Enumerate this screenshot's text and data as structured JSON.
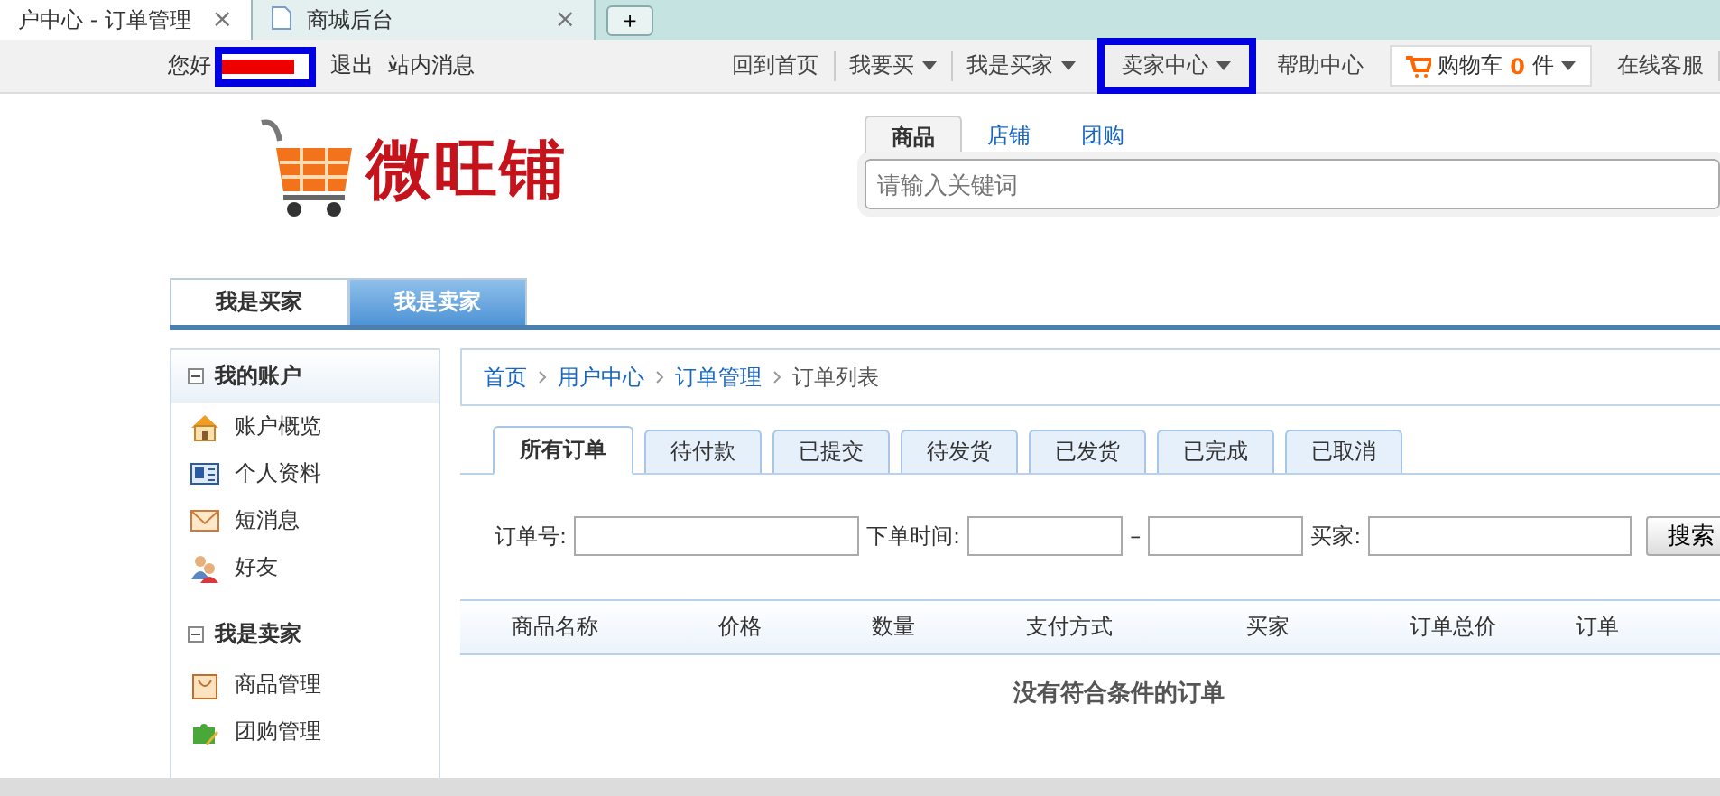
{
  "browser_tabs": [
    {
      "title": "户中心 - 订单管理",
      "close": "×",
      "selected": true
    },
    {
      "title": "商城后台",
      "close": "×",
      "selected": false
    }
  ],
  "new_tab": "+",
  "top_bar": {
    "greeting": "您好",
    "links": [
      "退出",
      "站内消息"
    ],
    "right": [
      {
        "kind": "link",
        "label": "回到首页"
      },
      {
        "kind": "menu",
        "label": "我要买",
        "highlighted": false
      },
      {
        "kind": "menu",
        "label": "我是买家",
        "highlighted": false
      },
      {
        "kind": "menu",
        "label": "卖家中心",
        "highlighted": true
      },
      {
        "kind": "link",
        "label": "帮助中心"
      },
      {
        "kind": "cart",
        "label": "购物车",
        "count": "0",
        "unit": "件"
      },
      {
        "kind": "link",
        "label": "在线客服"
      }
    ]
  },
  "logo": {
    "text": "微旺铺"
  },
  "search": {
    "tabs": [
      {
        "label": "商品",
        "selected": true
      },
      {
        "label": "店铺",
        "selected": false
      },
      {
        "label": "团购",
        "selected": false
      }
    ],
    "placeholder": "请输入关键词"
  },
  "role_tabs": [
    {
      "label": "我是买家",
      "selected": false
    },
    {
      "label": "我是卖家",
      "selected": true
    }
  ],
  "sidebar": [
    {
      "title": "我的账户",
      "expanded": true,
      "items": [
        {
          "label": "账户概览"
        },
        {
          "label": "个人资料"
        },
        {
          "label": "短消息"
        },
        {
          "label": "好友"
        }
      ]
    },
    {
      "title": "我是卖家",
      "expanded": true,
      "items": [
        {
          "label": "商品管理"
        },
        {
          "label": "团购管理"
        }
      ]
    }
  ],
  "breadcrumb": [
    {
      "label": "首页",
      "link": true
    },
    {
      "label": "用户中心",
      "link": true
    },
    {
      "label": "订单管理",
      "link": true
    },
    {
      "label": "订单列表",
      "link": false
    }
  ],
  "order_tabs": [
    {
      "label": "所有订单",
      "selected": true
    },
    {
      "label": "待付款",
      "selected": false
    },
    {
      "label": "已提交",
      "selected": false
    },
    {
      "label": "待发货",
      "selected": false
    },
    {
      "label": "已发货",
      "selected": false
    },
    {
      "label": "已完成",
      "selected": false
    },
    {
      "label": "已取消",
      "selected": false
    }
  ],
  "filters": {
    "order_no_label": "订单号:",
    "time_label": "下单时间:",
    "range_sep": "–",
    "buyer_label": "买家:",
    "search_button": "搜索"
  },
  "table": {
    "columns": [
      "商品名称",
      "价格",
      "数量",
      "支付方式",
      "买家",
      "订单总价",
      "订单"
    ],
    "empty_message": "没有符合条件的订单"
  }
}
